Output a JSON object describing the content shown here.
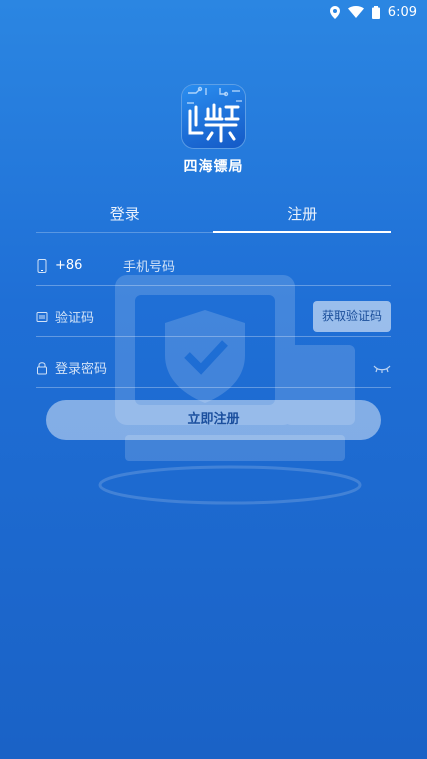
{
  "status_bar": {
    "time": "6:09",
    "icons": [
      "location-icon",
      "wifi-icon",
      "battery-icon"
    ]
  },
  "app": {
    "name": "四海镖局",
    "logo_icon": "circuit-logo-icon"
  },
  "tabs": [
    {
      "label": "登录",
      "active": false
    },
    {
      "label": "注册",
      "active": true
    }
  ],
  "form": {
    "phone": {
      "prefix": "+86",
      "placeholder": "手机号码",
      "icon": "phone-icon"
    },
    "code": {
      "placeholder": "验证码",
      "icon": "code-icon",
      "button_label": "获取验证码"
    },
    "password": {
      "placeholder": "登录密码",
      "icon": "lock-icon",
      "toggle_icon": "eye-closed-icon"
    }
  },
  "submit": {
    "label": "立即注册"
  },
  "colors": {
    "background": "#1f6fd6",
    "button_text": "#1b4f9e"
  }
}
